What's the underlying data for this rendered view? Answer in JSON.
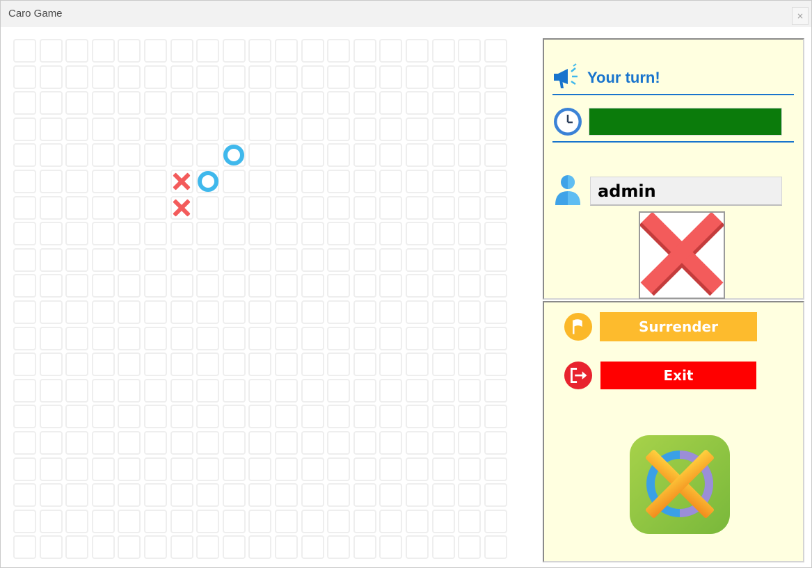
{
  "window": {
    "title": "Caro Game",
    "close_label": "×"
  },
  "board": {
    "rows": 20,
    "cols": 19,
    "moves": [
      {
        "row": 4,
        "col": 8,
        "mark": "O"
      },
      {
        "row": 5,
        "col": 6,
        "mark": "X"
      },
      {
        "row": 5,
        "col": 7,
        "mark": "O"
      },
      {
        "row": 6,
        "col": 6,
        "mark": "X"
      }
    ]
  },
  "status": {
    "turn_text": "Your turn!",
    "icon": "megaphone-icon"
  },
  "timer": {
    "icon": "clock-icon",
    "progress": 1.0,
    "color": "#0b7b0b"
  },
  "player": {
    "icon": "user-icon",
    "name": "admin",
    "mark": "X"
  },
  "actions": {
    "surrender_label": "Surrender",
    "surrender_icon": "flag-icon",
    "exit_label": "Exit",
    "exit_icon": "exit-icon"
  },
  "logo": {
    "icon": "caro-logo-icon"
  },
  "colors": {
    "panel_bg": "#ffffe0",
    "accent_blue": "#1874cd",
    "x_red": "#f35b5b",
    "o_blue": "#3fb8ec",
    "surrender": "#fdbb2d",
    "exit": "#ff0000"
  }
}
